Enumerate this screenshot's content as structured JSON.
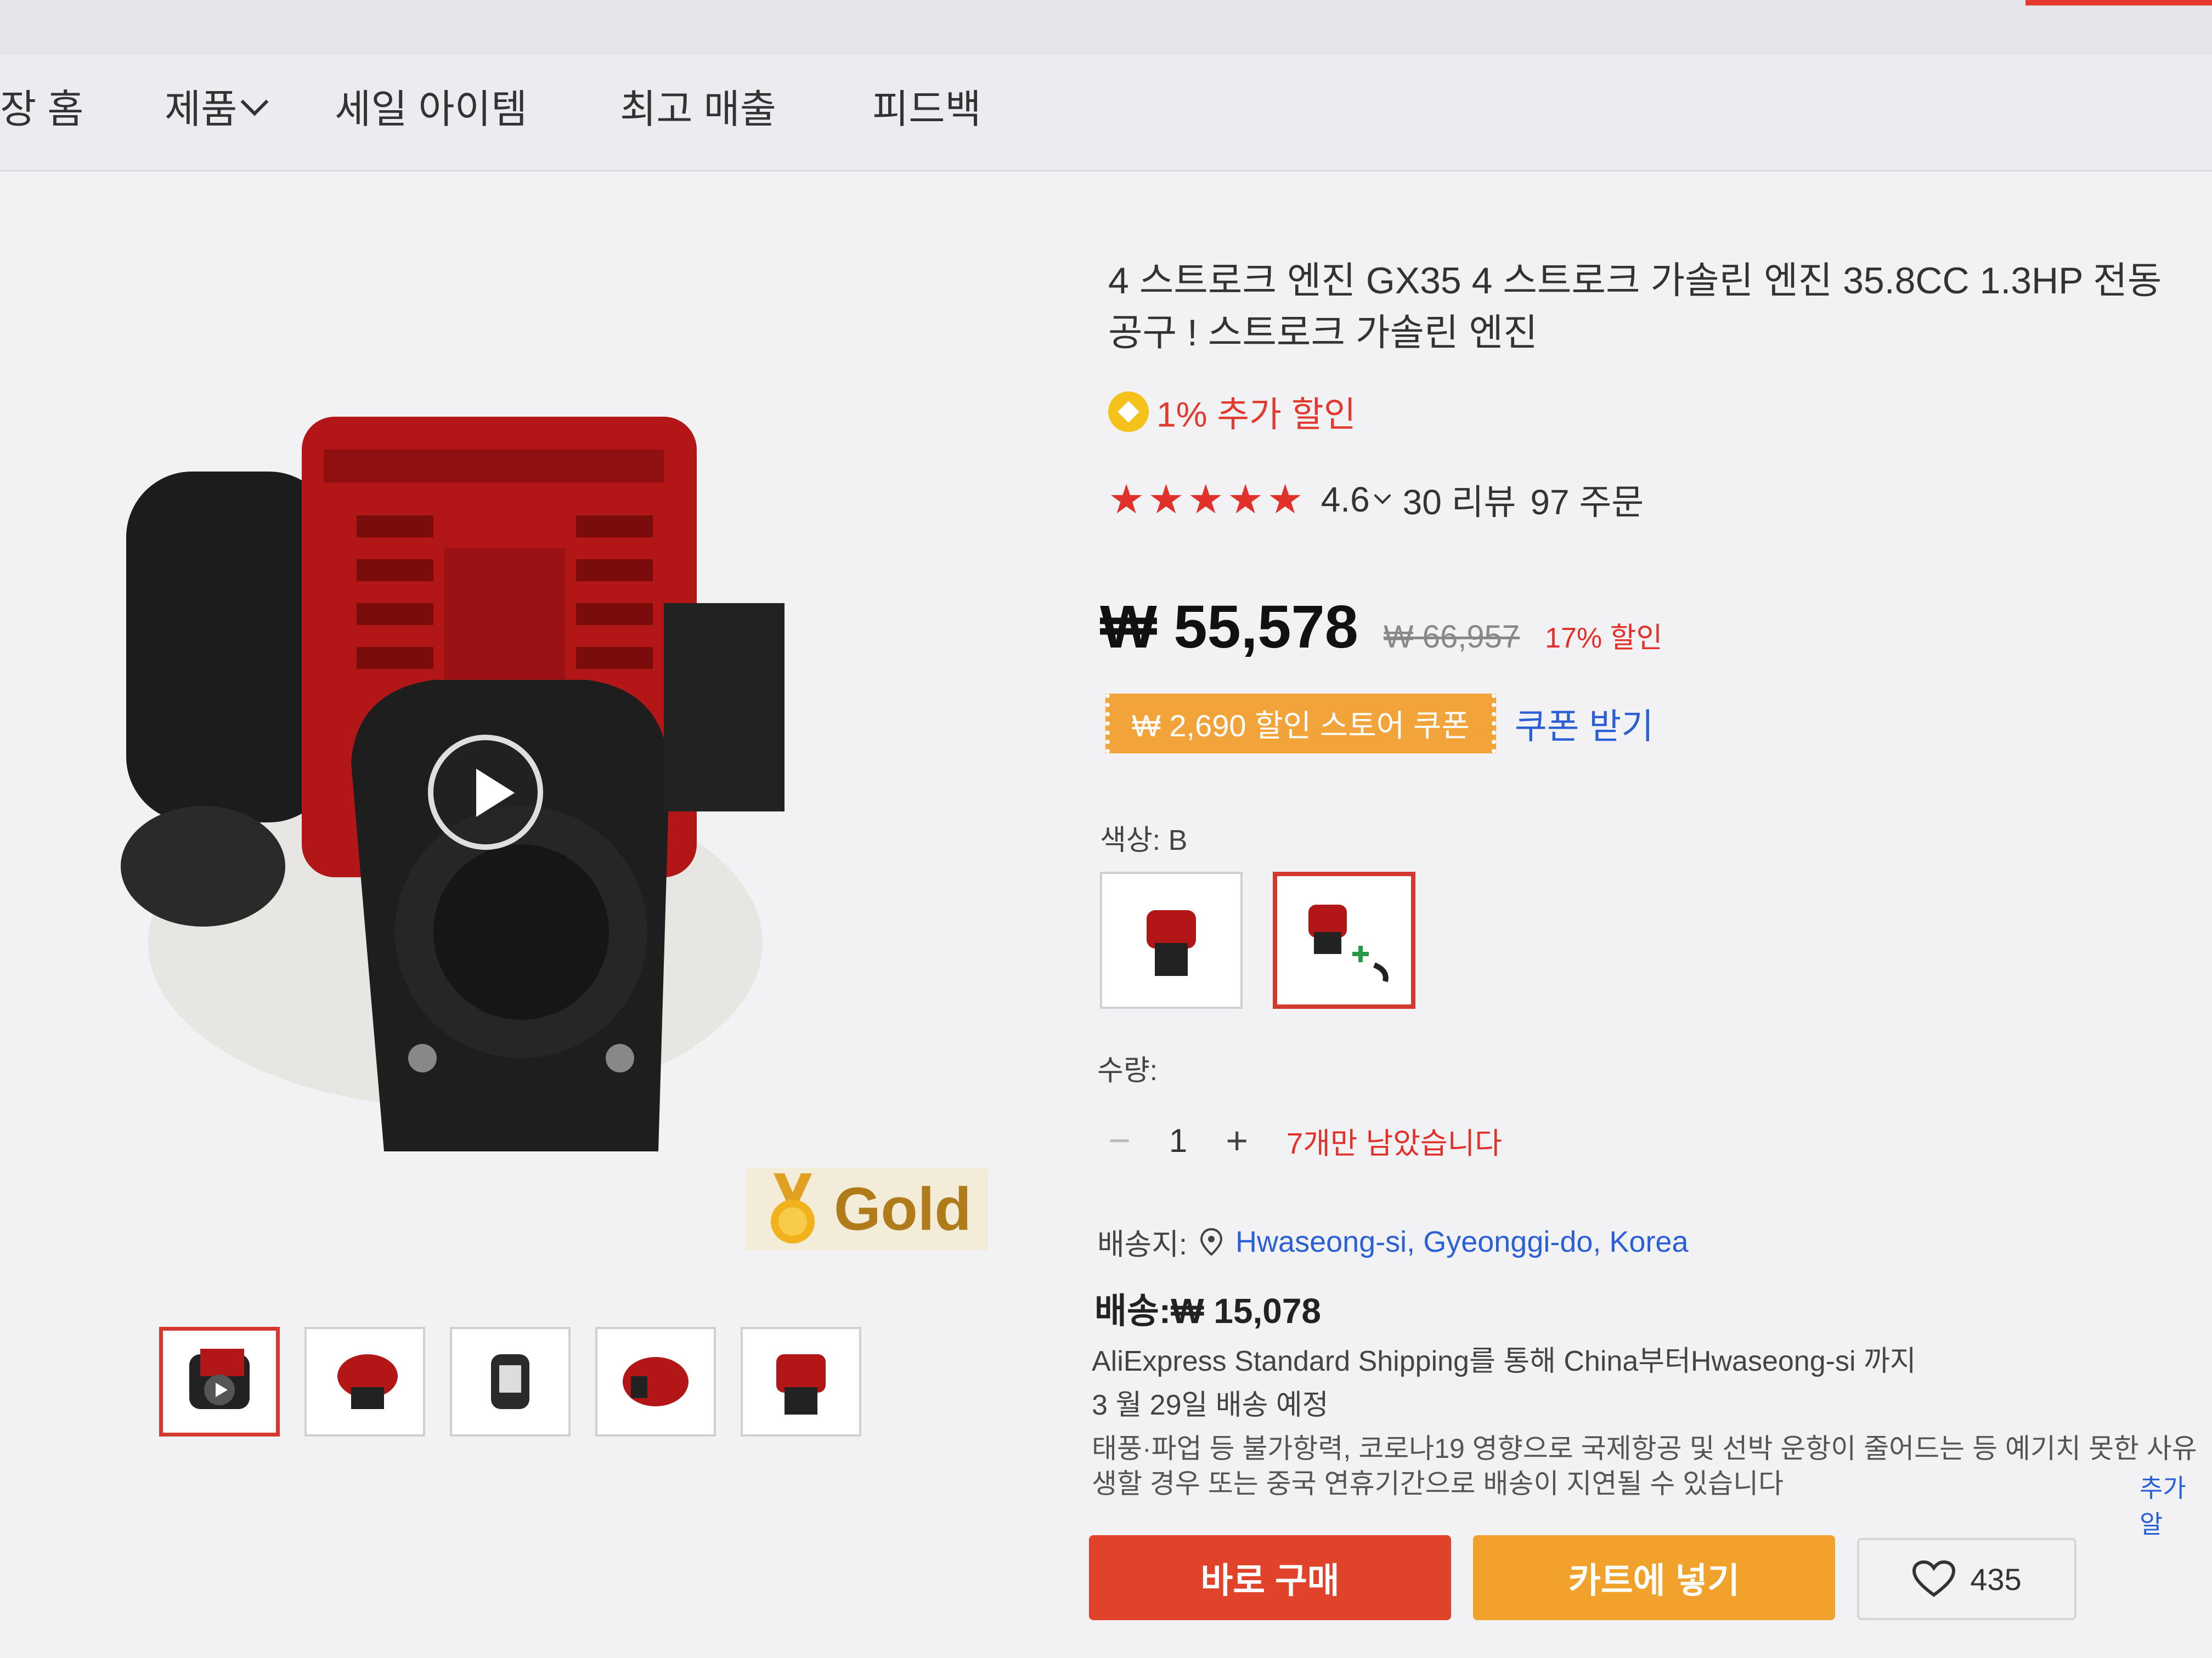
{
  "nav": {
    "items": [
      "장 홈",
      "제품",
      "세일 아이템",
      "최고 매출",
      "피드백"
    ]
  },
  "gallery": {
    "badge": "Gold",
    "play_icon": "play-icon"
  },
  "product": {
    "title": "4 스트로크 엔진 GX35 4 스트로크 가솔린 엔진 35.8CC 1.3HP 전동 공구 ! 스트로크 가솔린 엔진",
    "extra_discount": "1% 추가 할인",
    "rating": "4.6",
    "reviews": "30 리뷰",
    "orders": "97 주문",
    "price": "₩ 55,578",
    "original_price": "₩ 66,957",
    "discount": "17% 할인",
    "coupon": "₩ 2,690 할인 스토어 쿠폰",
    "coupon_get": "쿠폰 받기",
    "color_label": "색상: B",
    "quantity_label": "수량:",
    "quantity": "1",
    "qty_minus": "−",
    "qty_plus": "+",
    "stock": "7개만 남았습니다",
    "ship_to_label": "배송지:",
    "ship_to": "Hwaseong-si, Gyeonggi-do, Korea",
    "shipping_cost": "배송:₩ 15,078",
    "shipping_desc": "AliExpress Standard Shipping를 통해 China부터Hwaseong-si 까지",
    "delivery_date": "3 월 29일 배송 예정",
    "notice_line1": "태풍·파업 등 불가항력, 코로나19 영향으로 국제항공 및 선박 운항이 줄어드는 등 예기치 못한 사유",
    "notice_line2": "생할 경우 또는 중국 연휴기간으로 배송이 지연될 수 있습니다",
    "notice_more": "추가 알",
    "buy_now": "바로 구매",
    "add_to_cart": "카트에 넣기",
    "wishlist_count": "435"
  },
  "colors": {
    "accent": "#e2302a",
    "link": "#2a5fd6",
    "coupon": "#f2a33a",
    "buy": "#e0432a",
    "cart": "#f0a22c"
  }
}
